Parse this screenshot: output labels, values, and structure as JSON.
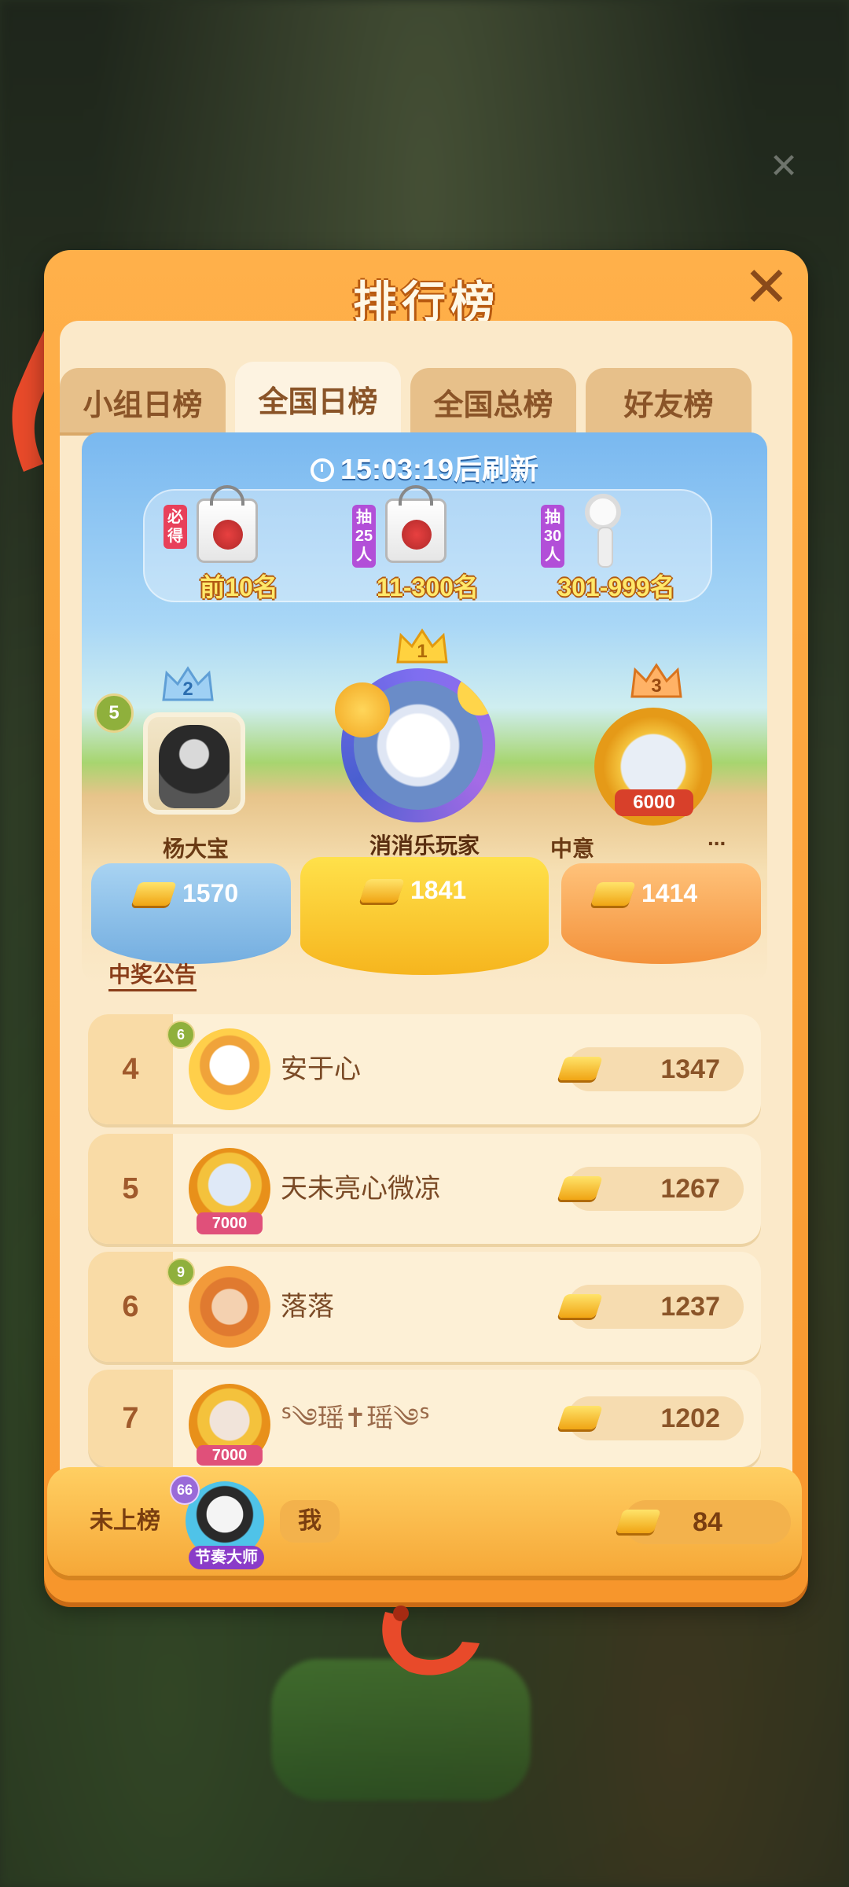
{
  "title": "排行榜",
  "tabs": [
    {
      "label": "小组日榜",
      "active": false
    },
    {
      "label": "全国日榜",
      "active": true
    },
    {
      "label": "全国总榜",
      "active": false
    },
    {
      "label": "好友榜",
      "active": false
    }
  ],
  "refresh_text": "15:03:19后刷新",
  "prizes": [
    {
      "tag": "必得",
      "label": "前10名",
      "item": "bag"
    },
    {
      "tag": "抽25人",
      "label": "11-300名",
      "item": "bag"
    },
    {
      "tag": "抽30人",
      "label": "301-999名",
      "item": "fan"
    }
  ],
  "podium": [
    {
      "rank": "1",
      "name": "消消乐玩家",
      "score": "1841"
    },
    {
      "rank": "2",
      "name": "杨大宝",
      "score": "1570",
      "level": "5"
    },
    {
      "rank": "3",
      "name": "中意",
      "score": "1414",
      "frame_badge": "6000",
      "more": "..."
    }
  ],
  "notice": "中奖公告",
  "list": [
    {
      "rank": "4",
      "name": "安于心",
      "score": "1347",
      "level": "6"
    },
    {
      "rank": "5",
      "name": "天未亮心微凉",
      "score": "1267",
      "frame_badge": "7000"
    },
    {
      "rank": "6",
      "name": "落落",
      "score": "1237",
      "level": "9"
    },
    {
      "rank": "7",
      "name": "ᔆ༄瑶✝瑶༄ᔆ",
      "score": "1202",
      "frame_badge": "7000"
    }
  ],
  "me": {
    "status": "未上榜",
    "name": "我",
    "score": "84",
    "level": "66",
    "badge": "节奏大师"
  },
  "colors": {
    "panel_orange": "#f7962c",
    "gold": "#f0a514",
    "text_brown": "#7a4a26"
  }
}
